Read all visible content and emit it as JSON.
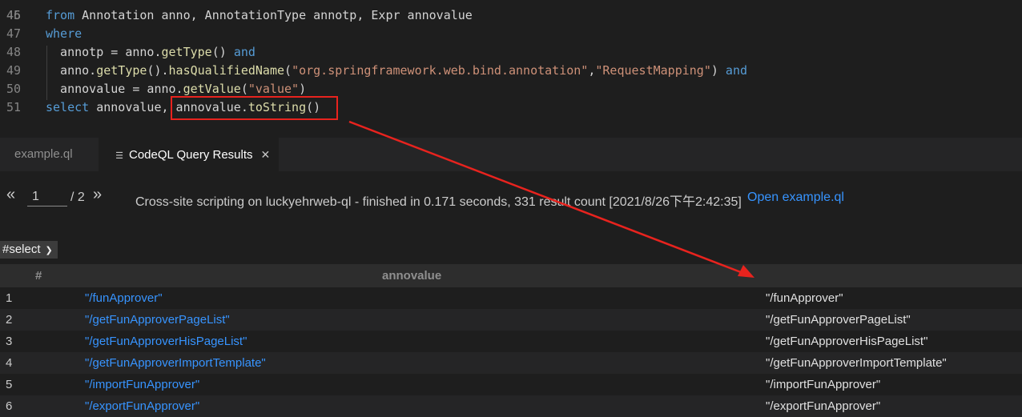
{
  "editor": {
    "lines": [
      {
        "num": "46",
        "tokens": [
          {
            "t": "from",
            "c": "kw"
          },
          {
            "t": " Annotation anno, AnnotationType annotp, Expr annovalue",
            "c": ""
          }
        ]
      },
      {
        "num": "47",
        "tokens": [
          {
            "t": "where",
            "c": "kw"
          }
        ]
      },
      {
        "num": "48",
        "tokens": [
          {
            "t": "  annotp = anno.",
            "c": ""
          },
          {
            "t": "getType",
            "c": "fn"
          },
          {
            "t": "() ",
            "c": ""
          },
          {
            "t": "and",
            "c": "kw"
          }
        ]
      },
      {
        "num": "49",
        "tokens": [
          {
            "t": "  anno.",
            "c": ""
          },
          {
            "t": "getType",
            "c": "fn"
          },
          {
            "t": "().",
            "c": ""
          },
          {
            "t": "hasQualifiedName",
            "c": "fn"
          },
          {
            "t": "(",
            "c": ""
          },
          {
            "t": "\"org.springframework.web.bind.annotation\"",
            "c": "str"
          },
          {
            "t": ",",
            "c": ""
          },
          {
            "t": "\"RequestMapping\"",
            "c": "str"
          },
          {
            "t": ") ",
            "c": ""
          },
          {
            "t": "and",
            "c": "kw"
          }
        ]
      },
      {
        "num": "50",
        "tokens": [
          {
            "t": "  annovalue = anno.",
            "c": ""
          },
          {
            "t": "getValue",
            "c": "fn"
          },
          {
            "t": "(",
            "c": ""
          },
          {
            "t": "\"value\"",
            "c": "str"
          },
          {
            "t": ")",
            "c": ""
          }
        ]
      },
      {
        "num": "51",
        "tokens": [
          {
            "t": "select",
            "c": "kw"
          },
          {
            "t": " annovalue, annovalue.",
            "c": ""
          },
          {
            "t": "toString",
            "c": "fn"
          },
          {
            "t": "()",
            "c": ""
          }
        ]
      }
    ]
  },
  "tabs": [
    {
      "label": "example.ql",
      "icon": "ql-file-icon",
      "active": false
    },
    {
      "label": "CodeQL Query Results",
      "icon": "results-icon",
      "active": true,
      "close": "✕"
    }
  ],
  "pager": {
    "prev": "«",
    "page": "1",
    "total": "/ 2",
    "next": "»"
  },
  "status_text": "Cross-site scripting on luckyehrweb-ql - finished in 0.171 seconds, 331 result count [2021/8/26下午2:42:35]",
  "open_link": "Open example.ql",
  "result_set": "#select",
  "table": {
    "headers": [
      "#",
      "annovalue",
      ""
    ],
    "rows": [
      {
        "n": "1",
        "link": "\"/funApprover\"",
        "str": "\"/funApprover\""
      },
      {
        "n": "2",
        "link": "\"/getFunApproverPageList\"",
        "str": "\"/getFunApproverPageList\""
      },
      {
        "n": "3",
        "link": "\"/getFunApproverHisPageList\"",
        "str": "\"/getFunApproverHisPageList\""
      },
      {
        "n": "4",
        "link": "\"/getFunApproverImportTemplate\"",
        "str": "\"/getFunApproverImportTemplate\""
      },
      {
        "n": "5",
        "link": "\"/importFunApprover\"",
        "str": "\"/importFunApprover\""
      },
      {
        "n": "6",
        "link": "\"/exportFunApprover\"",
        "str": "\"/exportFunApprover\""
      }
    ]
  },
  "colors": {
    "annotation_red": "#e8231e",
    "link_blue": "#3794ff"
  }
}
